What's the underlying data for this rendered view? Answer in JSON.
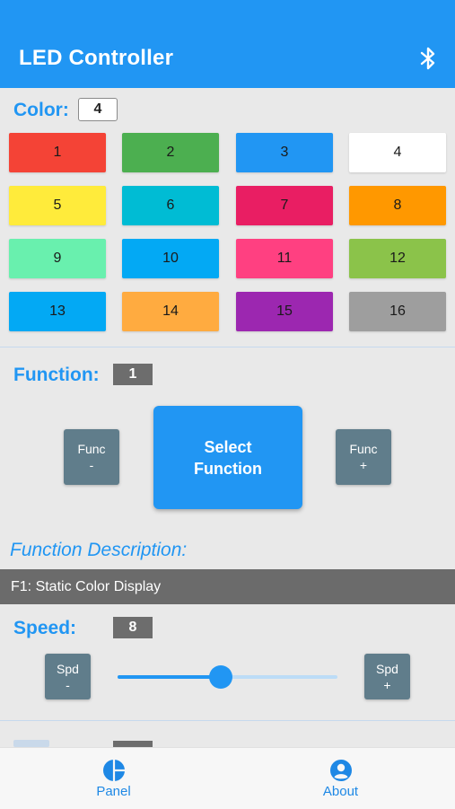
{
  "app": {
    "title": "LED Controller",
    "bluetooth_icon": "bluetooth-icon"
  },
  "color_section": {
    "label": "Color:",
    "value": "4",
    "swatches": [
      {
        "label": "1",
        "color": "#f44336"
      },
      {
        "label": "2",
        "color": "#4caf50"
      },
      {
        "label": "3",
        "color": "#2196f3"
      },
      {
        "label": "4",
        "color": "#ffffff"
      },
      {
        "label": "5",
        "color": "#ffeb3b"
      },
      {
        "label": "6",
        "color": "#00bcd4"
      },
      {
        "label": "7",
        "color": "#e91e63"
      },
      {
        "label": "8",
        "color": "#ff9800"
      },
      {
        "label": "9",
        "color": "#69f0ae"
      },
      {
        "label": "10",
        "color": "#03a9f4"
      },
      {
        "label": "11",
        "color": "#ff4081"
      },
      {
        "label": "12",
        "color": "#8bc34a"
      },
      {
        "label": "13",
        "color": "#03a9f4"
      },
      {
        "label": "14",
        "color": "#ffab40"
      },
      {
        "label": "15",
        "color": "#9c27b0"
      },
      {
        "label": "16",
        "color": "#9e9e9e"
      }
    ]
  },
  "function_section": {
    "label": "Function:",
    "value": "1",
    "func_minus": {
      "line1": "Func",
      "line2": "-"
    },
    "func_plus": {
      "line1": "Func",
      "line2": "+"
    },
    "select": {
      "line1": "Select",
      "line2": "Function"
    },
    "description_label": "Function Description:",
    "description": "F1: Static Color Display"
  },
  "speed_section": {
    "label": "Speed:",
    "value": "8",
    "spd_minus": {
      "line1": "Spd",
      "line2": "-"
    },
    "spd_plus": {
      "line1": "Spd",
      "line2": "+"
    },
    "slider_fraction": 0.47
  },
  "nav": {
    "items": [
      {
        "label": "Panel",
        "icon": "pie-chart-icon"
      },
      {
        "label": "About",
        "icon": "account-circle-icon"
      }
    ]
  },
  "colors": {
    "accent": "#2196f3",
    "button_grey": "#607d8b",
    "value_dark": "#6d6d6d"
  }
}
